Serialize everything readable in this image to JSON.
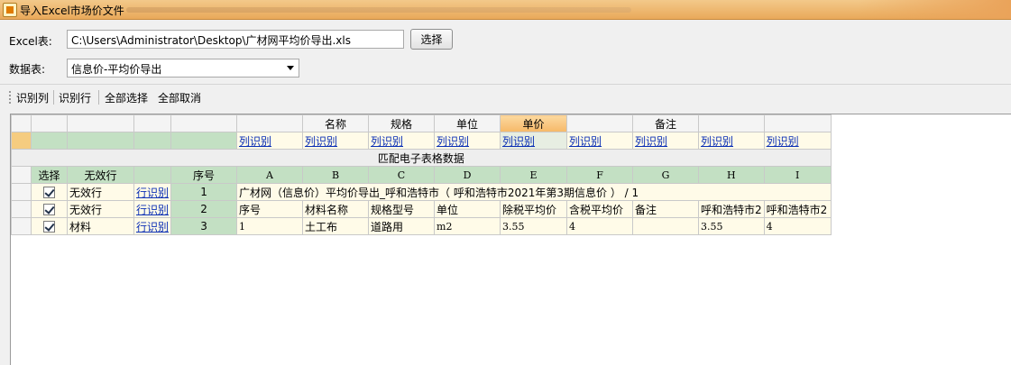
{
  "window": {
    "title": "导入Excel市场价文件"
  },
  "form": {
    "excel_label": "Excel表:",
    "excel_path": "C:\\Users\\Administrator\\Desktop\\广材网平均价导出.xls",
    "browse_label": "选择",
    "sheet_label": "数据表:",
    "sheet_value": "信息价-平均价导出"
  },
  "toolbar": {
    "identify_column": "识别列",
    "identify_row": "识别行",
    "select_all": "全部选择",
    "deselect_all": "全部取消"
  },
  "grid": {
    "header_fields": [
      "",
      "名称",
      "规格",
      "单位",
      "单价",
      "",
      "备注",
      "",
      ""
    ],
    "selected_header": "单价",
    "identify_link": "列识别",
    "section_title": "匹配电子表格数据",
    "column_headers": {
      "select": "选择",
      "invalid": "无效行",
      "serial": "序号",
      "letters": [
        "A",
        "B",
        "C",
        "D",
        "E",
        "F",
        "G",
        "H",
        "I"
      ]
    },
    "row_identify_link": "行识别",
    "rows": [
      {
        "type": "无效行",
        "no": "1",
        "cells": [
          "广材网（信息价）平均价导出_呼和浩特市（ 呼和浩特市2021年第3期信息价 ） / 1",
          "",
          "",
          "",
          "",
          "",
          "",
          "",
          ""
        ]
      },
      {
        "type": "无效行",
        "no": "2",
        "cells": [
          "序号",
          "材料名称",
          "规格型号",
          "单位",
          "除税平均价",
          "含税平均价",
          "备注",
          "呼和浩特市2",
          "呼和浩特市2"
        ]
      },
      {
        "type": "材料",
        "no": "3",
        "cells": [
          "1",
          "土工布",
          "道路用",
          "m2",
          "3.55",
          "4",
          "",
          "3.55",
          "4"
        ]
      }
    ]
  }
}
